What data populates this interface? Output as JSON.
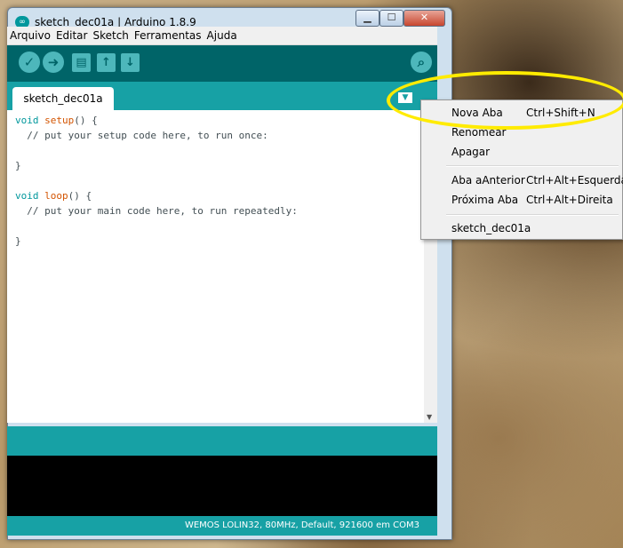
{
  "window": {
    "title": "sketch_dec01a | Arduino 1.8.9",
    "app_icon": "∞",
    "controls": {
      "minimize": "▁",
      "maximize": "☐",
      "close": "✕"
    }
  },
  "menubar": [
    "Arquivo",
    "Editar",
    "Sketch",
    "Ferramentas",
    "Ajuda"
  ],
  "toolbar": {
    "verify": "✓",
    "upload": "➜",
    "new": "▤",
    "open": "↑",
    "save": "↓",
    "serial_monitor": "⌕"
  },
  "tab": {
    "name": "sketch_dec01a",
    "menu_button": "▼"
  },
  "code": {
    "line1_kw": "void",
    "line1_fn": "setup",
    "line1_rest": "() {",
    "line2": "  // put your setup code here, to run once:",
    "line4": "}",
    "line6_kw": "void",
    "line6_fn": "loop",
    "line6_rest": "() {",
    "line7": "  // put your main code here, to run repeatedly:",
    "line9": "}"
  },
  "status": "WEMOS LOLIN32, 80MHz, Default, 921600 em COM3",
  "context_menu": {
    "new_tab": {
      "label": "Nova Aba",
      "shortcut": "Ctrl+Shift+N"
    },
    "rename": {
      "label": "Renomear"
    },
    "delete": {
      "label": "Apagar"
    },
    "prev_tab": {
      "label": "Aba aAnterior",
      "shortcut": "Ctrl+Alt+Esquerda"
    },
    "next_tab": {
      "label": "Próxima Aba",
      "shortcut": "Ctrl+Alt+Direita"
    },
    "sketch": {
      "label": "sketch_dec01a"
    }
  },
  "colors": {
    "toolbar": "#006468",
    "teal": "#17a1a5",
    "highlight": "#ffeb00"
  }
}
